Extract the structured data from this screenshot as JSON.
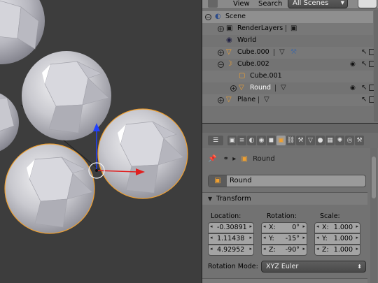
{
  "outliner": {
    "menu": {
      "view": "View",
      "search": "Search"
    },
    "scene_selector": "All Scenes",
    "tree": [
      {
        "label": "Scene",
        "icon": "scene-icon",
        "indent": 0,
        "expand": "−"
      },
      {
        "label": "RenderLayers",
        "icon": "render-layers-icon",
        "indent": 1,
        "expand": "+"
      },
      {
        "label": "World",
        "icon": "world-icon",
        "indent": 1,
        "expand": ""
      },
      {
        "label": "Cube.000",
        "icon": "mesh-object-icon",
        "indent": 1,
        "expand": "+"
      },
      {
        "label": "Cube.002",
        "icon": "empty-object-icon",
        "indent": 1,
        "expand": "−"
      },
      {
        "label": "Cube.001",
        "icon": "mesh-object-icon",
        "indent": 2,
        "expand": ""
      },
      {
        "label": "Round",
        "icon": "mesh-object-icon",
        "indent": 2,
        "expand": "+",
        "selected": true
      },
      {
        "label": "Plane",
        "icon": "mesh-object-icon",
        "indent": 1,
        "expand": "+"
      }
    ]
  },
  "properties": {
    "context_object": "Round",
    "name_field": "Round",
    "transform_panel": "Transform",
    "location_label": "Location:",
    "rotation_label": "Rotation:",
    "scale_label": "Scale:",
    "location": [
      "-0.30891",
      "1.11438",
      "4.92952"
    ],
    "rotation_axes": [
      "X:",
      "Y:",
      "Z:"
    ],
    "rotation": [
      "0°",
      "-15°",
      "-90°"
    ],
    "scale_axes": [
      "X:",
      "Y:",
      "Z:"
    ],
    "scale": [
      "1.000",
      "1.000",
      "1.000"
    ],
    "rotation_mode_label": "Rotation Mode:",
    "rotation_mode": "XYZ Euler"
  },
  "colors": {
    "selection_outline": "#f0a030",
    "axis_x": "#e02020",
    "axis_z": "#2040ff"
  }
}
